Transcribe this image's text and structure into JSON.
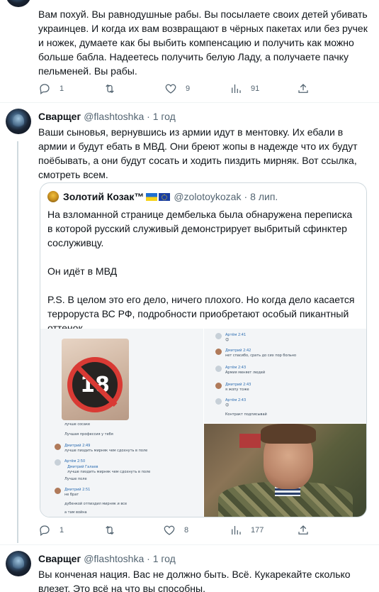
{
  "tweet1": {
    "text": "Вам похуй. Вы равнодушные рабы. Вы посылаете своих детей убивать украинцев. И когда их вам возвращают в чёрных пакетах или без ручек и ножек, думаете как бы выбить компенсацию и получить как можно больше бабла. Надеетесь получить белую Ладу, а получаете пачку пельменей. Вы рабы.",
    "replies": "1",
    "retweets": "",
    "likes": "9",
    "views": "91"
  },
  "tweet2": {
    "name": "Сварщег",
    "handle": "@flashtoshka",
    "sep": "·",
    "time": "1 год",
    "text": "Ваши сыновья, вернувшись из армии идут в ментовку. Их ебали в армии и будут ебать в МВД. Они бреют жопы в надежде что их будут поёбывать, а они будут сосать и ходить пиздить мирняк. Вот ссылка, смотреть всем.",
    "replies": "1",
    "retweets": "",
    "likes": "8",
    "views": "177",
    "quote": {
      "name": "Золотий Козак™",
      "handle": "@zolotoykozak",
      "sep": "·",
      "time": "8 лип.",
      "para1": "На взломанной странице дембелька была обнаружена переписка в которой русский служивый демонстрирует выбритый сфинктер сослуживцу.",
      "para2": "Он идёт в МВД",
      "para3": "P.S. В целом это его дело, ничего плохого. Но когда дело касается терроруста ВС РФ, подробности приобретают особый пикантный оттенок.",
      "badge": "18",
      "chat_left": [
        {
          "name": "",
          "text": "лучше сосаке"
        },
        {
          "name": "",
          "text": "Лучшая профессия у тебя"
        },
        {
          "name": "Дмитрий 2:49",
          "text": "лучше пиздить мирняк чем сдохнуть в поле"
        },
        {
          "name": "Артём 2:50",
          "text": "Дмитрий Галаев"
        },
        {
          "name": "",
          "text": "лучше пиздить мирняк чем сдохнуть в поле"
        },
        {
          "name": "",
          "text": "Лучше поле"
        },
        {
          "name": "Дмитрий 2:51",
          "text": "не брат"
        },
        {
          "name": "",
          "text": "дубенкой отпиздил мирняк и все"
        },
        {
          "name": "",
          "text": "а там война"
        }
      ],
      "chat_right": [
        {
          "name": "Артём 2:41",
          "text": "😊"
        },
        {
          "name": "Дмитрий 2:42",
          "text": "нет спасибо, срать до сих пор больно"
        },
        {
          "name": "Артём 2:43",
          "text": "Армия меняет людей"
        },
        {
          "name": "Дмитрий 2:43",
          "text": "я жопу тоже"
        },
        {
          "name": "Артём 2:43",
          "text": "😊"
        },
        {
          "name": "",
          "text": "Контракт подписывай"
        }
      ]
    }
  },
  "tweet3": {
    "name": "Сварщег",
    "handle": "@flashtoshka",
    "sep": "·",
    "time": "1 год",
    "text": "Вы конченая нация. Вас не должно быть.  Всё. Кукарекайте сколько влезет. Это всё на что вы способны."
  }
}
